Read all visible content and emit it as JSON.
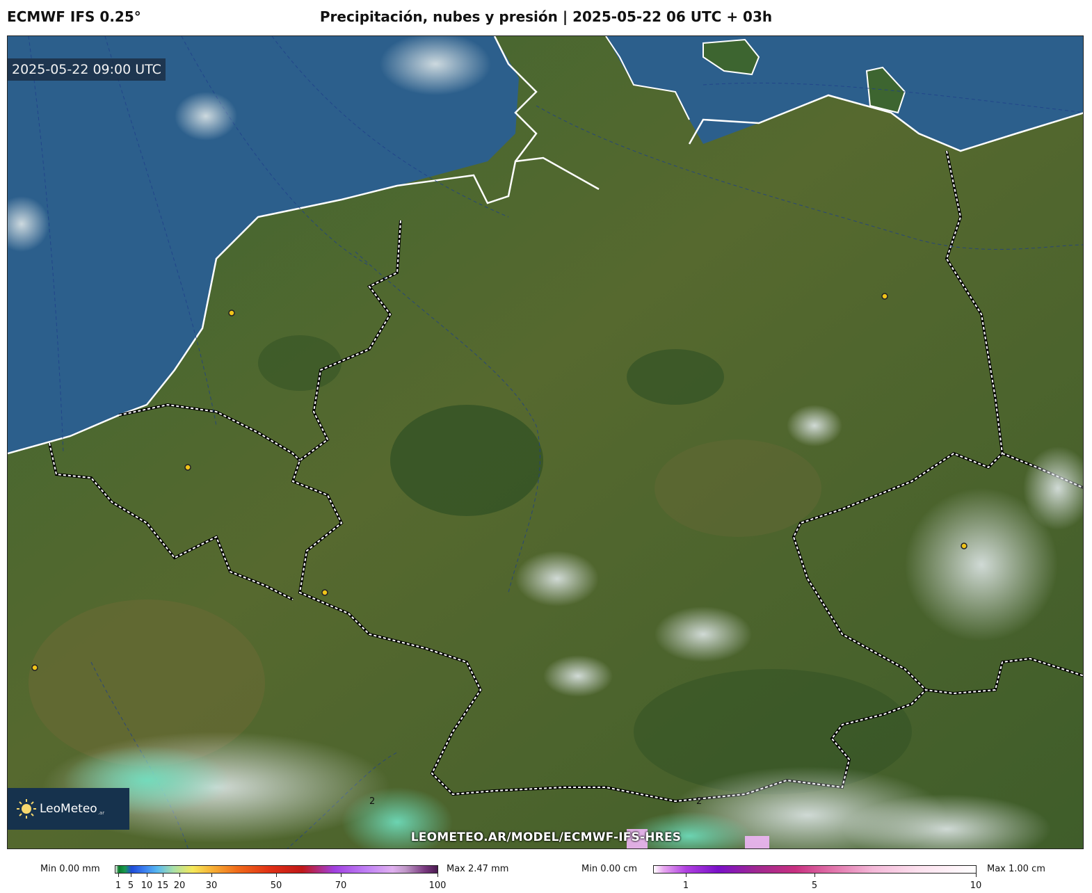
{
  "header": {
    "model": "ECMWF IFS 0.25°",
    "title": "Precipitación, nubes y presión | 2025-05-22 06 UTC + 03h"
  },
  "map": {
    "valid_time": "2025-05-22 09:00 UTC",
    "watermark": "LEOMETEO.AR/MODEL/ECMWF-IFS-HRES",
    "logo": {
      "name": "LeoMeteo",
      "suffix": ".ar"
    },
    "isobar_labels": [
      "2",
      "2"
    ],
    "colors": {
      "sea": "#2b5f8e",
      "land": "#4a6a2c",
      "border": "#ffffff",
      "city_dot": "#f0c419"
    }
  },
  "legend_precip": {
    "min_label": "Min 0.00 mm",
    "max_label": "Max 2.47 mm",
    "ticks": [
      "1",
      "5",
      "10",
      "15",
      "20",
      "30",
      "50",
      "70",
      "100"
    ]
  },
  "legend_snow": {
    "min_label": "Min 0.00 cm",
    "max_label": "Max 1.00 cm",
    "ticks": [
      "1",
      "5",
      "10"
    ]
  }
}
